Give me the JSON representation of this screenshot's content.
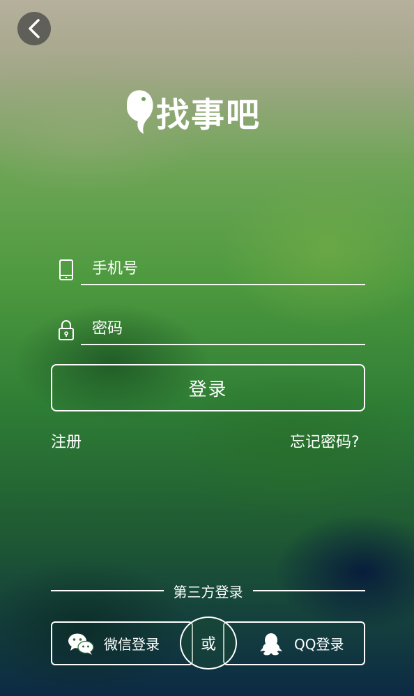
{
  "header": {
    "back_icon": "back-arrow-icon"
  },
  "logo": {
    "text": "找事吧",
    "mark_icon": "fish-logo-icon"
  },
  "form": {
    "phone": {
      "placeholder": "手机号",
      "icon": "phone-icon"
    },
    "password": {
      "placeholder": "密码",
      "icon": "lock-icon"
    },
    "login_label": "登录"
  },
  "links": {
    "register": "注册",
    "forgot": "忘记密码?"
  },
  "third_party": {
    "title": "第三方登录",
    "wechat_label": "微信登录",
    "or_label": "或",
    "qq_label": "QQ登录"
  },
  "colors": {
    "accent": "#ffffff",
    "back_button_bg": "#464646"
  }
}
